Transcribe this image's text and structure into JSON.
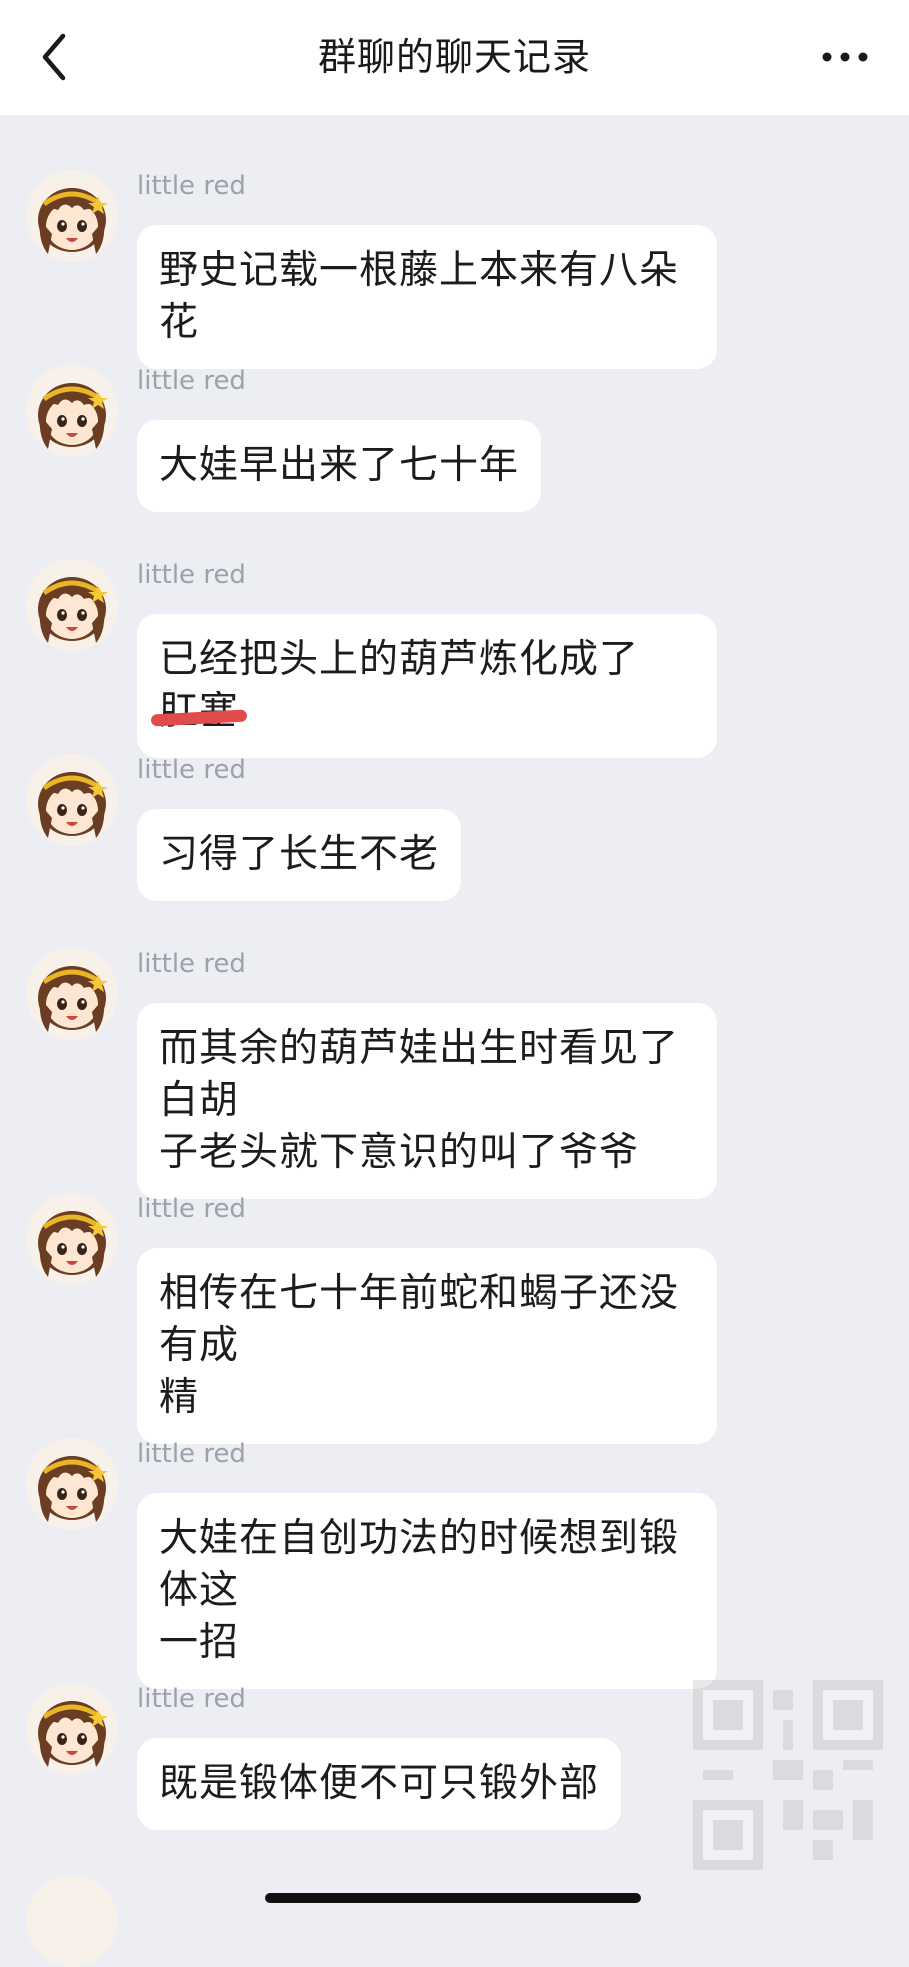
{
  "header": {
    "title": "群聊的聊天记录",
    "back_icon": "chevron-left-icon",
    "more_icon": "more-horizontal-icon"
  },
  "messages": [
    {
      "sender": "little red",
      "text": "野史记载一根藤上本来有八朵花"
    },
    {
      "sender": "little red",
      "text": "大娃早出来了七十年"
    },
    {
      "sender": "little red",
      "text_before": "已经把头上的葫芦炼化成了",
      "text_struck": "肛塞"
    },
    {
      "sender": "little red",
      "text": "习得了长生不老"
    },
    {
      "sender": "little red",
      "text_line1": "而其余的葫芦娃出生时看见了白胡",
      "text_line2": "子老头就下意识的叫了爷爷"
    },
    {
      "sender": "little red",
      "text_line1": "相传在七十年前蛇和蝎子还没有成",
      "text_line2": "精"
    },
    {
      "sender": "little red",
      "text_line1": "大娃在自创功法的时候想到锻体这",
      "text_line2": "一招"
    },
    {
      "sender": "little red",
      "text": "既是锻体便不可只锻外部"
    }
  ],
  "colors": {
    "background": "#eceef3",
    "bubble": "#ffffff",
    "sender": "#9da1a8",
    "strike": "#e04b4b"
  }
}
